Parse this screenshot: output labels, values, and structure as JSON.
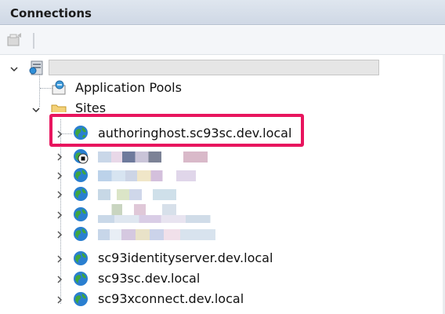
{
  "header": {
    "title": "Connections"
  },
  "icons": {
    "globe": "globe-icon",
    "server": "server-icon",
    "app_pools": "app-pools-icon",
    "folder": "sites-folder-icon"
  },
  "colors": {
    "highlight": "#e8155e"
  },
  "tree": {
    "app_pools_label": "Application Pools",
    "sites_label": "Sites",
    "sites": [
      {
        "label": "authoringhost.sc93sc.dev.local"
      },
      {
        "label": "sc93identityserver.dev.local"
      },
      {
        "label": "sc93sc.dev.local"
      },
      {
        "label": "sc93xconnect.dev.local"
      }
    ]
  }
}
